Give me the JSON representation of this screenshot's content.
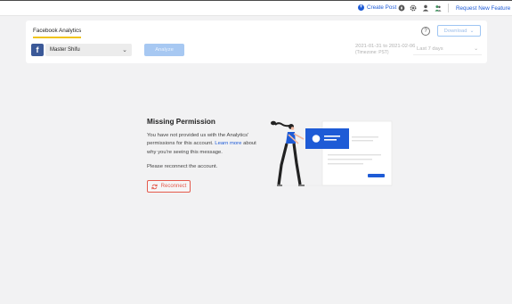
{
  "header": {
    "create_post_label": "Create Post",
    "request_feature_label": "Request New Feature",
    "icons": [
      "add-circle-icon",
      "compass-icon",
      "gear-icon",
      "user-icon",
      "team-icon"
    ]
  },
  "analytics": {
    "tab_label": "Facebook Analytics",
    "help_label": "?",
    "download_label": "Download",
    "account_name": "Master Shifu",
    "analyze_label": "Analyze",
    "date_range": "2021-01-31 to 2021-02-06",
    "timezone": "(Timezone: PST)",
    "period_label": "Last 7 days"
  },
  "permission": {
    "title": "Missing Permission",
    "desc_before": "You have not provided us with the Analytics' permissions for this account.",
    "learn_more": "Learn more",
    "desc_after": "about why you're seeing this message.",
    "reconnect_message": "Please reconnect the account.",
    "reconnect_label": "Reconnect"
  },
  "colors": {
    "accent": "#1e5bd6",
    "tab_underline": "#f0c419",
    "facebook": "#3b5998",
    "danger": "#e45a4c",
    "analyze_disabled": "#a7c8f2"
  }
}
